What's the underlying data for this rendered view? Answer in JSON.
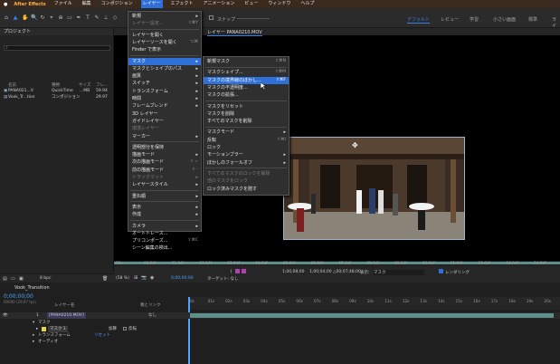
{
  "menubar": {
    "app": "After Effects",
    "items": [
      "ファイル",
      "編集",
      "コンポジション",
      "レイヤー",
      "エフェクト",
      "アニメーション",
      "ビュー",
      "ウィンドウ",
      "ヘルプ"
    ],
    "active_index": 3
  },
  "workspace": {
    "items": [
      "デフォルト",
      "レビュー",
      "学習",
      "小さい画面",
      "標準",
      "ライブラリ"
    ]
  },
  "toolbar": {
    "snap": "スナップ"
  },
  "project": {
    "title": "プロジェクト",
    "columns": [
      "名前",
      "種類",
      "サイズ",
      "フレ..."
    ],
    "rows": [
      {
        "name": "PANA021...V",
        "type": "QuickTime",
        "size": "...MB",
        "fps": "59.94"
      },
      {
        "name": "Vook_Tr...tion",
        "type": "コンポジション",
        "size": "",
        "fps": "29.97"
      }
    ],
    "bpc": "8 bpc"
  },
  "comp": {
    "tab": "レイヤー PANA0210.MOV"
  },
  "menu_layer": [
    {
      "label": "新規",
      "arrow": true
    },
    {
      "label": "レイヤー設定...",
      "sc": "⇧⌘Y",
      "dis": true
    },
    {
      "sep": true
    },
    {
      "label": "レイヤーを開く"
    },
    {
      "label": "レイヤーソースを開く",
      "sc": "⌥⌘"
    },
    {
      "label": "Finder で表示"
    },
    {
      "sep": true
    },
    {
      "label": "マスク",
      "arrow": true,
      "hl": true
    },
    {
      "label": "マスクとシェイプのパス",
      "arrow": true
    },
    {
      "label": "画質",
      "arrow": true
    },
    {
      "label": "スイッチ",
      "arrow": true
    },
    {
      "label": "トランスフォーム",
      "arrow": true
    },
    {
      "label": "時間",
      "arrow": true
    },
    {
      "label": "フレームブレンド",
      "arrow": true
    },
    {
      "label": "3D レイヤー"
    },
    {
      "label": "ガイドレイヤー"
    },
    {
      "label": "環境レイヤー",
      "dis": true
    },
    {
      "label": "マーカー",
      "arrow": true
    },
    {
      "sep": true
    },
    {
      "label": "透明部分を保持"
    },
    {
      "label": "描画モード",
      "arrow": true
    },
    {
      "label": "次の描画モード",
      "sc": "⇧ ="
    },
    {
      "label": "前の描画モード",
      "sc": "⇧ -"
    },
    {
      "label": "トラックマット",
      "arrow": true,
      "dis": true
    },
    {
      "label": "レイヤースタイル",
      "arrow": true
    },
    {
      "sep": true
    },
    {
      "label": "重ね順",
      "arrow": true
    },
    {
      "sep": true
    },
    {
      "label": "表示",
      "arrow": true
    },
    {
      "label": "作成",
      "arrow": true
    },
    {
      "sep": true
    },
    {
      "label": "カメラ",
      "arrow": true
    },
    {
      "label": "オートトレース..."
    },
    {
      "label": "プリコンポーズ...",
      "sc": "⇧⌘C"
    },
    {
      "label": "シーン編集の検出..."
    }
  ],
  "menu_mask": [
    {
      "label": "新規マスク",
      "sc": "⇧⌘N"
    },
    {
      "sep": true
    },
    {
      "label": "マスクシェイプ...",
      "sc": "⇧⌘M"
    },
    {
      "label": "マスクの境界線のぼかし...",
      "sc": "⇧⌘F",
      "hl": true
    },
    {
      "label": "マスクの不透明度..."
    },
    {
      "label": "マスクの拡張..."
    },
    {
      "sep": true
    },
    {
      "label": "マスクをリセット"
    },
    {
      "label": "マスクを削除"
    },
    {
      "label": "すべてのマスクを削除"
    },
    {
      "sep": true
    },
    {
      "label": "マスクモード",
      "arrow": true
    },
    {
      "label": "反転",
      "sc": "⇧⌘I"
    },
    {
      "label": "ロック"
    },
    {
      "label": "モーションブラー",
      "arrow": true
    },
    {
      "label": "ぼかしのフォールオフ",
      "arrow": true
    },
    {
      "sep": true
    },
    {
      "label": "すべてのマスクのロックを解除",
      "dis": true
    },
    {
      "label": "他のマスクをロック",
      "dis": true
    },
    {
      "label": "ロック済みマスクを隠す"
    }
  ],
  "ruler": [
    "59s",
    "00:04f",
    "01:04f",
    "02:04f",
    "03:04f",
    "04:04f",
    "05:04f",
    "06:04f",
    "07:04f",
    "08:04f",
    "09:04f",
    "10:04f",
    "11:04f",
    "12:04f",
    "13:04f",
    "14:04f"
  ],
  "viewbar": {
    "zoom": "(58 %)",
    "time": "0;00;00;00",
    "t1": "1;00,08;00",
    "t2": "1;00;04;00",
    "t3": "△00;07;48;00",
    "view_label": "表示:",
    "view_value": "マスク",
    "render": "レンダリング",
    "target": "ターゲット: なし"
  },
  "timeline": {
    "tab": "Vook_Transition",
    "timecode": "0;00;00;00",
    "fps_note": "00000 (29.97 fps)",
    "header": {
      "layer": "レイヤー名",
      "parent": "親とリンク"
    },
    "layer_num": "1",
    "layer_name": "[PANA0210.MOV]",
    "parent_value": "なし",
    "sub": [
      "マスク",
      "マスク 1",
      "トランスフォーム",
      "オーディオ"
    ],
    "mask_mode": "加算",
    "mask_invert": "反転",
    "reset": "リセット",
    "ruler": [
      "0s",
      "01s",
      "02s",
      "03s",
      "04s",
      "05s",
      "06s",
      "07s",
      "08s",
      "09s",
      "10s",
      "11s",
      "12s",
      "13s",
      "14s",
      "15s",
      "16s",
      "17s",
      "18s",
      "19s",
      "20s"
    ]
  },
  "colors": {
    "accent": "#2e6fd8",
    "workspace_active": "#3a7de8",
    "app_name": "#ffb24a",
    "timeline_bar": "#5e8f8a"
  }
}
